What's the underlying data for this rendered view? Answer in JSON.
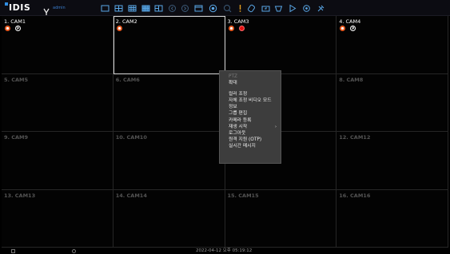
{
  "app": {
    "logo": "IDIS",
    "user": "admin"
  },
  "toolbar": {
    "icons": [
      "single-view-icon",
      "grid-2x2-icon",
      "grid-3x3-icon",
      "grid-4x4-icon",
      "grid-custom-icon",
      "prev-page-icon",
      "next-page-icon",
      "fullscreen-icon",
      "playback-icon",
      "search-icon",
      "alarm-icon",
      "clip-icon",
      "export-icon",
      "marker-icon",
      "play-icon",
      "settings-icon",
      "tools-icon"
    ]
  },
  "cameras": [
    {
      "label": "1. CAM1",
      "active": true,
      "icons": [
        "rec",
        "p"
      ]
    },
    {
      "label": "2. CAM2",
      "active": true,
      "icons": [
        "rec"
      ]
    },
    {
      "label": "3. CAM3",
      "active": true,
      "icons": [
        "rec",
        "red"
      ]
    },
    {
      "label": "4. CAM4",
      "active": true,
      "icons": [
        "rec",
        "p"
      ]
    },
    {
      "label": "5. CAM5",
      "active": false,
      "icons": []
    },
    {
      "label": "6. CAM6",
      "active": false,
      "icons": []
    },
    {
      "label": "",
      "active": false,
      "icons": []
    },
    {
      "label": "8. CAM8",
      "active": false,
      "icons": []
    },
    {
      "label": "9. CAM9",
      "active": false,
      "icons": []
    },
    {
      "label": "10. CAM10",
      "active": false,
      "icons": []
    },
    {
      "label": "",
      "active": false,
      "icons": []
    },
    {
      "label": "12. CAM12",
      "active": false,
      "icons": []
    },
    {
      "label": "13. CAM13",
      "active": false,
      "icons": []
    },
    {
      "label": "14. CAM14",
      "active": false,
      "icons": []
    },
    {
      "label": "15. CAM15",
      "active": false,
      "icons": []
    },
    {
      "label": "16. CAM16",
      "active": false,
      "icons": []
    }
  ],
  "selected_camera_index": 1,
  "context_menu": {
    "items": [
      {
        "label": "PTZ",
        "disabled": true
      },
      {
        "label": "확대",
        "disabled": false
      },
      {
        "separator": true
      },
      {
        "label": "컬러 조정",
        "disabled": false
      },
      {
        "label": "자체 조정 비디오 모드",
        "disabled": false
      },
      {
        "label": "정보",
        "disabled": false
      },
      {
        "label": "그룹 편집",
        "disabled": false
      },
      {
        "label": "카메라 등록",
        "disabled": false
      },
      {
        "label": "재생 시작",
        "disabled": false,
        "submenu": true
      },
      {
        "label": "로그아웃",
        "disabled": false
      },
      {
        "label": "원격 지원 (OTP)",
        "disabled": false
      },
      {
        "label": "실시간 메시지",
        "disabled": false
      }
    ]
  },
  "status": {
    "datetime": "2022-04-12  오후 05:19:12"
  },
  "colors": {
    "accent": "#2f8ce0",
    "rec": "#e85a20",
    "alarm": "#e01010",
    "menu_bg": "#3d3d3d"
  }
}
